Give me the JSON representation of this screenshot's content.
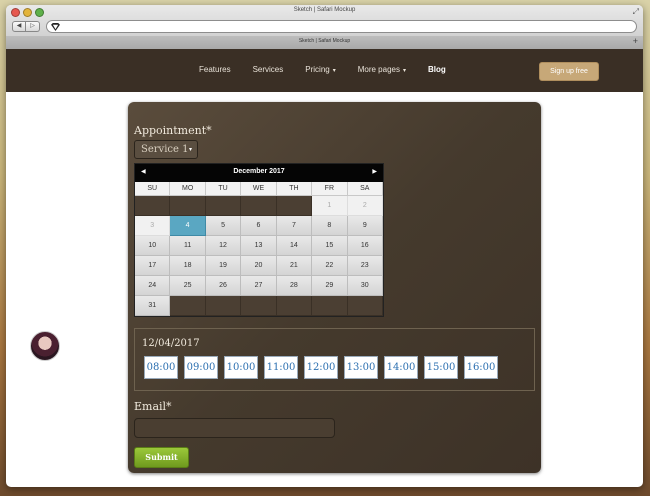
{
  "browser": {
    "window_title": "Sketch | Safari Mockup",
    "tab_title": "Sketch | Safari Mockup",
    "back_glyph": "◀",
    "forward_glyph": "▷",
    "plus_glyph": "+",
    "resize_glyph": "⤢"
  },
  "nav": {
    "features": "Features",
    "services": "Services",
    "pricing": "Pricing",
    "more_pages": "More pages",
    "blog": "Blog",
    "caret": "▾",
    "signup": "Sign up free"
  },
  "form": {
    "appointment_label": "Appointment*",
    "service_selected": "Service 1",
    "select_arrow": "▾",
    "calendar": {
      "month_title": "December 2017",
      "prev": "◀",
      "next": "▶",
      "weekdays": [
        "SU",
        "MO",
        "TU",
        "WE",
        "TH",
        "FR",
        "SA"
      ],
      "weeks": [
        [
          "",
          "",
          "",
          "",
          "",
          "1",
          "2"
        ],
        [
          "3",
          "4",
          "5",
          "6",
          "7",
          "8",
          "9"
        ],
        [
          "10",
          "11",
          "12",
          "13",
          "14",
          "15",
          "16"
        ],
        [
          "17",
          "18",
          "19",
          "20",
          "21",
          "22",
          "23"
        ],
        [
          "24",
          "25",
          "26",
          "27",
          "28",
          "29",
          "30"
        ],
        [
          "31",
          "",
          "",
          "",
          "",
          "",
          ""
        ]
      ],
      "selected_day": "4",
      "faded_days": [
        "1",
        "2",
        "3"
      ]
    },
    "selected_date": "12/04/2017",
    "time_slots": [
      "08:00",
      "09:00",
      "10:00",
      "11:00",
      "12:00",
      "13:00",
      "14:00",
      "15:00",
      "16:00"
    ],
    "email_label": "Email*",
    "email_value": "",
    "submit_label": "Submit"
  },
  "colors": {
    "nav_bg": "#3a2f25",
    "signup_bg": "#c7a878",
    "selected_day": "#5aa7c2",
    "submit_green": "#8ab832",
    "slot_text": "#2b6fb0"
  }
}
